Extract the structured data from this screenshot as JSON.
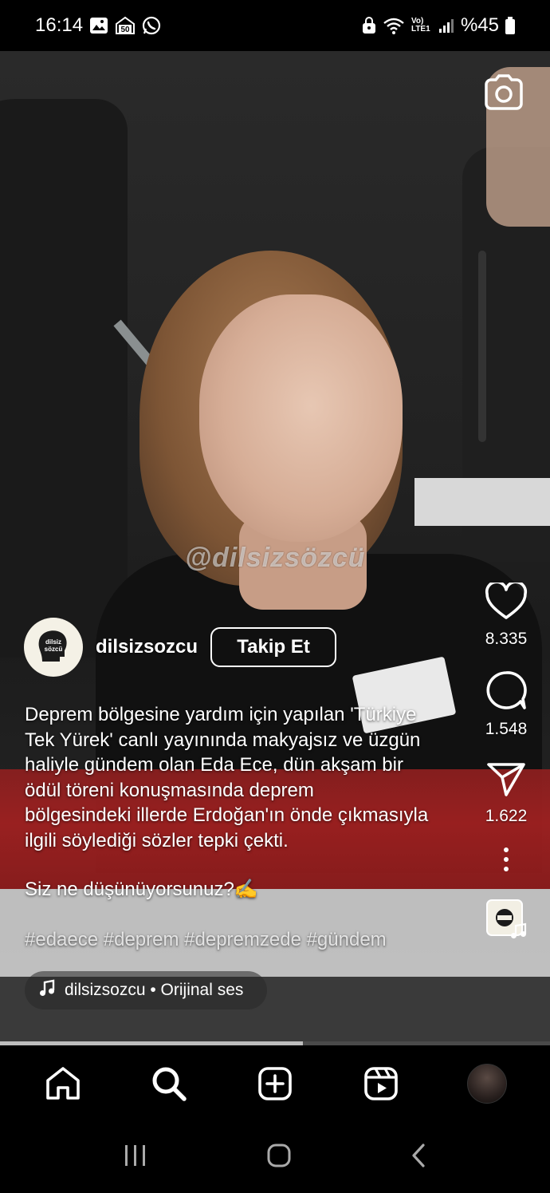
{
  "status_bar": {
    "time": "16:14",
    "battery": "%45",
    "network": "Vo) LTE1",
    "icons_left": [
      "gallery-icon",
      "50-badge-icon",
      "whatsapp-icon"
    ],
    "icons_right": [
      "lock-icon",
      "wifi-icon",
      "signal-icon",
      "battery-icon"
    ]
  },
  "video": {
    "watermark": "@dilsizsözcü",
    "progress": 0.55
  },
  "post": {
    "username": "dilsizsozcu",
    "follow_label": "Takip Et",
    "avatar_text": "dilsiz sözcü",
    "caption_lines": [
      "Deprem bölgesine yardım için yapılan 'Türkiye",
      "Tek Yürek' canlı yayınında makyajsız ve üzgün",
      "haliyle gündem olan Eda Ece, dün akşam bir",
      "ödül töreni konuşmasında deprem",
      "bölgesindeki illerde Erdoğan'ın önde çıkmasıyla",
      "ilgili söylediği sözler tepki çekti."
    ],
    "question": "Siz ne düşünüyorsunuz?✍️",
    "hashtags": "#edaece #deprem #depremzede #gündem",
    "audio": "dilsizsozcu • Orijinal ses"
  },
  "actions": {
    "likes": "8.335",
    "comments": "1.548",
    "shares": "1.622"
  },
  "nav": {
    "items": [
      "home-icon",
      "search-icon",
      "create-icon",
      "reels-icon",
      "profile-avatar"
    ]
  },
  "colors": {
    "background": "#000000",
    "text": "#ffffff",
    "banner_red": "#9f2020"
  }
}
